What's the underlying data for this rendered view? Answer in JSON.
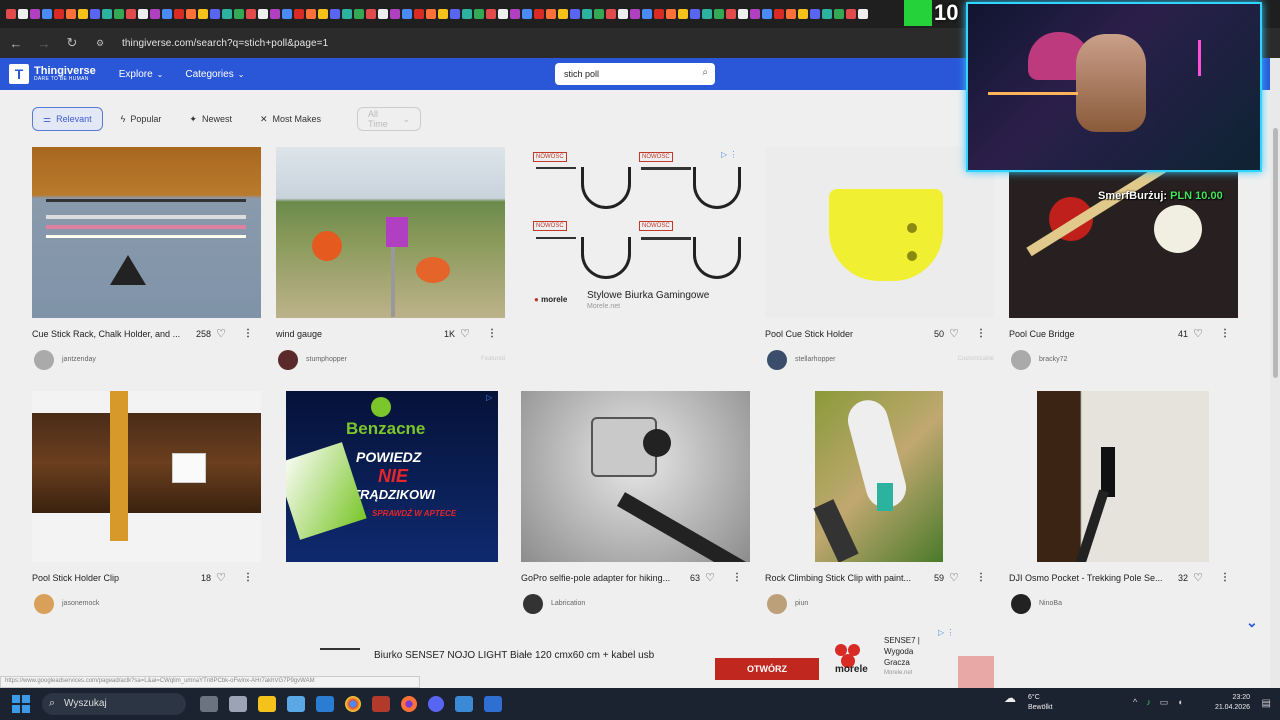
{
  "browser": {
    "url": "thingiverse.com/search?q=stich+poll&page=1"
  },
  "site": {
    "logo_name": "Thingiverse",
    "logo_tagline": "DARE TO BE HUMAN",
    "nav": [
      "Explore",
      "Categories"
    ],
    "search_value": "stich poll"
  },
  "filters": {
    "items": [
      "Relevant",
      "Popular",
      "Newest",
      "Most Makes"
    ],
    "active": "Relevant",
    "disabled_select": "All Time"
  },
  "cards": [
    {
      "title": "Cue Stick Rack, Chalk Holder, and ...",
      "likes": "258",
      "user": "jantzenday",
      "tag": ""
    },
    {
      "title": "wind gauge",
      "likes": "1K",
      "user": "stumphopper",
      "tag": "Featured"
    },
    {
      "title": "Pool Cue Stick Holder",
      "likes": "50",
      "user": "stellarhopper",
      "tag": "Customizable"
    },
    {
      "title": "Pool Cue Bridge",
      "likes": "41",
      "user": "bracky72",
      "tag": ""
    },
    {
      "title": "Pool Stick Holder Clip",
      "likes": "18",
      "user": "jasonemock",
      "tag": ""
    },
    {
      "title": "GoPro selfie-pole adapter for hiking...",
      "likes": "63",
      "user": "Labrication",
      "tag": ""
    },
    {
      "title": "Rock Climbing Stick Clip with paint...",
      "likes": "59",
      "user": "piun",
      "tag": ""
    },
    {
      "title": "DJI Osmo Pocket - Trekking Pole Se...",
      "likes": "32",
      "user": "NinoBa",
      "tag": ""
    }
  ],
  "ads": {
    "desk_ad_label": "NOWOŚĆ",
    "desk_ad_title": "Stylowe Biurka Gamingowe",
    "desk_ad_domain": "Morele.net",
    "desk_ad_brand": "morele",
    "acne_ad_brand": "Benzacne",
    "acne_ad_line1": "POWIEDZ",
    "acne_ad_line2": "NIE",
    "acne_ad_line3": "TRĄDZIKOWI",
    "acne_ad_line4": "SPRAWDŹ W APTECE",
    "bottom_ad_text": "Biurko SENSE7 NOJO LIGHT Białe 120 cmx60 cm + kabel usb",
    "bottom_ad_button": "OTWÓRZ",
    "bottom_ad_side_title": "SENSE7 | Wygoda Gracza",
    "bottom_ad_side_domain": "Morele.net",
    "bottom_ad_brand": "morele"
  },
  "status_url": "https://www.googleadservices.com/pagead/aclk?sa=L&ai=CWqlim_umnaYTn8PCbk-oFwinx-AHr7akhVG7P9gvWAM",
  "stream": {
    "donation_user": "SmerfBurżuj:",
    "donation_amount": "PLN 10.00",
    "counter": "10"
  },
  "taskbar": {
    "search_label": "Wyszukaj",
    "weather_temp": "6°C",
    "weather_desc": "Bewölkt",
    "time": "23:20",
    "date": "21.04.2026"
  }
}
